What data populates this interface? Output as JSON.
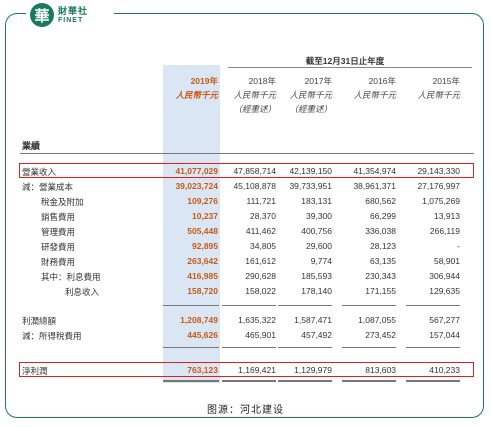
{
  "brand": {
    "mark": "華",
    "name_cn": "財華社",
    "name_en": "FINET"
  },
  "period_header": "截至12月31日止年度",
  "columns": [
    {
      "year": "2019年",
      "unit": "人民幣千元",
      "note": "",
      "current": true
    },
    {
      "year": "2018年",
      "unit": "人民幣千元",
      "note": "（經重述）",
      "current": false
    },
    {
      "year": "2017年",
      "unit": "人民幣千元",
      "note": "（經重述）",
      "current": false
    },
    {
      "year": "2016年",
      "unit": "人民幣千元",
      "note": "",
      "current": false
    },
    {
      "year": "2015年",
      "unit": "人民幣千元",
      "note": "",
      "current": false
    }
  ],
  "section_title": "業績",
  "rows": [
    {
      "label": "營業收入",
      "values": [
        "41,077,029",
        "47,858,714",
        "42,139,150",
        "41,354,974",
        "29,143,330"
      ]
    },
    {
      "label": "減：營業成本",
      "values": [
        "39,023,724",
        "45,108,878",
        "39,733,951",
        "38,961,371",
        "27,176,997"
      ]
    },
    {
      "label": "稅金及附加",
      "values": [
        "109,276",
        "111,721",
        "183,131",
        "680,562",
        "1,075,269"
      ]
    },
    {
      "label": "銷售費用",
      "values": [
        "10,237",
        "28,370",
        "39,300",
        "66,299",
        "13,913"
      ]
    },
    {
      "label": "管理費用",
      "values": [
        "505,448",
        "411,462",
        "400,756",
        "336,038",
        "266,119"
      ]
    },
    {
      "label": "研發費用",
      "values": [
        "92,895",
        "34,805",
        "29,600",
        "28,123",
        "-"
      ]
    },
    {
      "label": "財務費用",
      "values": [
        "263,642",
        "161,612",
        "9,774",
        "63,135",
        "58,901"
      ]
    },
    {
      "label": "其中：利息費用",
      "values": [
        "416,985",
        "290,628",
        "185,593",
        "230,343",
        "306,944"
      ]
    },
    {
      "label": "利息收入",
      "values": [
        "158,720",
        "158,022",
        "178,140",
        "171,155",
        "129,635"
      ]
    },
    {
      "label": "利潤總額",
      "values": [
        "1,208,749",
        "1,635,322",
        "1,587,471",
        "1,087,055",
        "567,277"
      ]
    },
    {
      "label": "減：所得稅費用",
      "values": [
        "445,626",
        "465,901",
        "457,492",
        "273,452",
        "157,044"
      ]
    },
    {
      "label": "淨利潤",
      "values": [
        "763,123",
        "1,169,421",
        "1,129,979",
        "813,603",
        "410,233"
      ]
    }
  ],
  "caption": "图源：河北建设",
  "colors": {
    "accent": "#c85a14",
    "highlight": "#dbe6f5",
    "frame": "#1a7a5a",
    "box": "#e0201a"
  }
}
